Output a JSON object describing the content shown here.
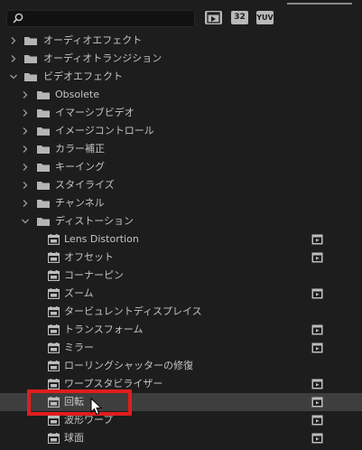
{
  "search": {
    "value": "",
    "placeholder": ""
  },
  "filters": [
    {
      "label": "32",
      "icon": "accelerated-effects-icon"
    },
    {
      "label": "32",
      "icon": "32-bit-effects-icon"
    },
    {
      "label": "YUV",
      "icon": "yuv-effects-icon"
    }
  ],
  "tree": [
    {
      "label": "オーディオエフェクト",
      "level": 0,
      "expanded": false,
      "type": "folder"
    },
    {
      "label": "オーディオトランジション",
      "level": 0,
      "expanded": false,
      "type": "folder"
    },
    {
      "label": "ビデオエフェクト",
      "level": 0,
      "expanded": true,
      "type": "folder"
    },
    {
      "label": "Obsolete",
      "level": 1,
      "expanded": false,
      "type": "folder"
    },
    {
      "label": "イマーシブビデオ",
      "level": 1,
      "expanded": false,
      "type": "folder"
    },
    {
      "label": "イメージコントロール",
      "level": 1,
      "expanded": false,
      "type": "folder"
    },
    {
      "label": "カラー補正",
      "level": 1,
      "expanded": false,
      "type": "folder"
    },
    {
      "label": "キーイング",
      "level": 1,
      "expanded": false,
      "type": "folder"
    },
    {
      "label": "スタイライズ",
      "level": 1,
      "expanded": false,
      "type": "folder"
    },
    {
      "label": "チャンネル",
      "level": 1,
      "expanded": false,
      "type": "folder"
    },
    {
      "label": "ディストーション",
      "level": 1,
      "expanded": true,
      "type": "folder"
    },
    {
      "label": "Lens Distortion",
      "level": 2,
      "type": "effect",
      "accelerated": true
    },
    {
      "label": "オフセット",
      "level": 2,
      "type": "effect",
      "accelerated": true
    },
    {
      "label": "コーナーピン",
      "level": 2,
      "type": "effect",
      "accelerated": false
    },
    {
      "label": "ズーム",
      "level": 2,
      "type": "effect",
      "accelerated": true
    },
    {
      "label": "タービュレントディスプレイス",
      "level": 2,
      "type": "effect",
      "accelerated": false
    },
    {
      "label": "トランスフォーム",
      "level": 2,
      "type": "effect",
      "accelerated": true
    },
    {
      "label": "ミラー",
      "level": 2,
      "type": "effect",
      "accelerated": true
    },
    {
      "label": "ローリングシャッターの修復",
      "level": 2,
      "type": "effect",
      "accelerated": false
    },
    {
      "label": "ワープスタビライザー",
      "level": 2,
      "type": "effect",
      "accelerated": true
    },
    {
      "label": "回転",
      "level": 2,
      "type": "effect",
      "accelerated": true,
      "selected": true
    },
    {
      "label": "波形ワープ",
      "level": 2,
      "type": "effect",
      "accelerated": true
    },
    {
      "label": "球面",
      "level": 2,
      "type": "effect",
      "accelerated": true
    }
  ],
  "colors": {
    "background": "#1d1d1d",
    "highlight_row": "#3e3e3e",
    "annotation_red": "#e01d1d",
    "icon_gray": "#bdbdbd"
  }
}
